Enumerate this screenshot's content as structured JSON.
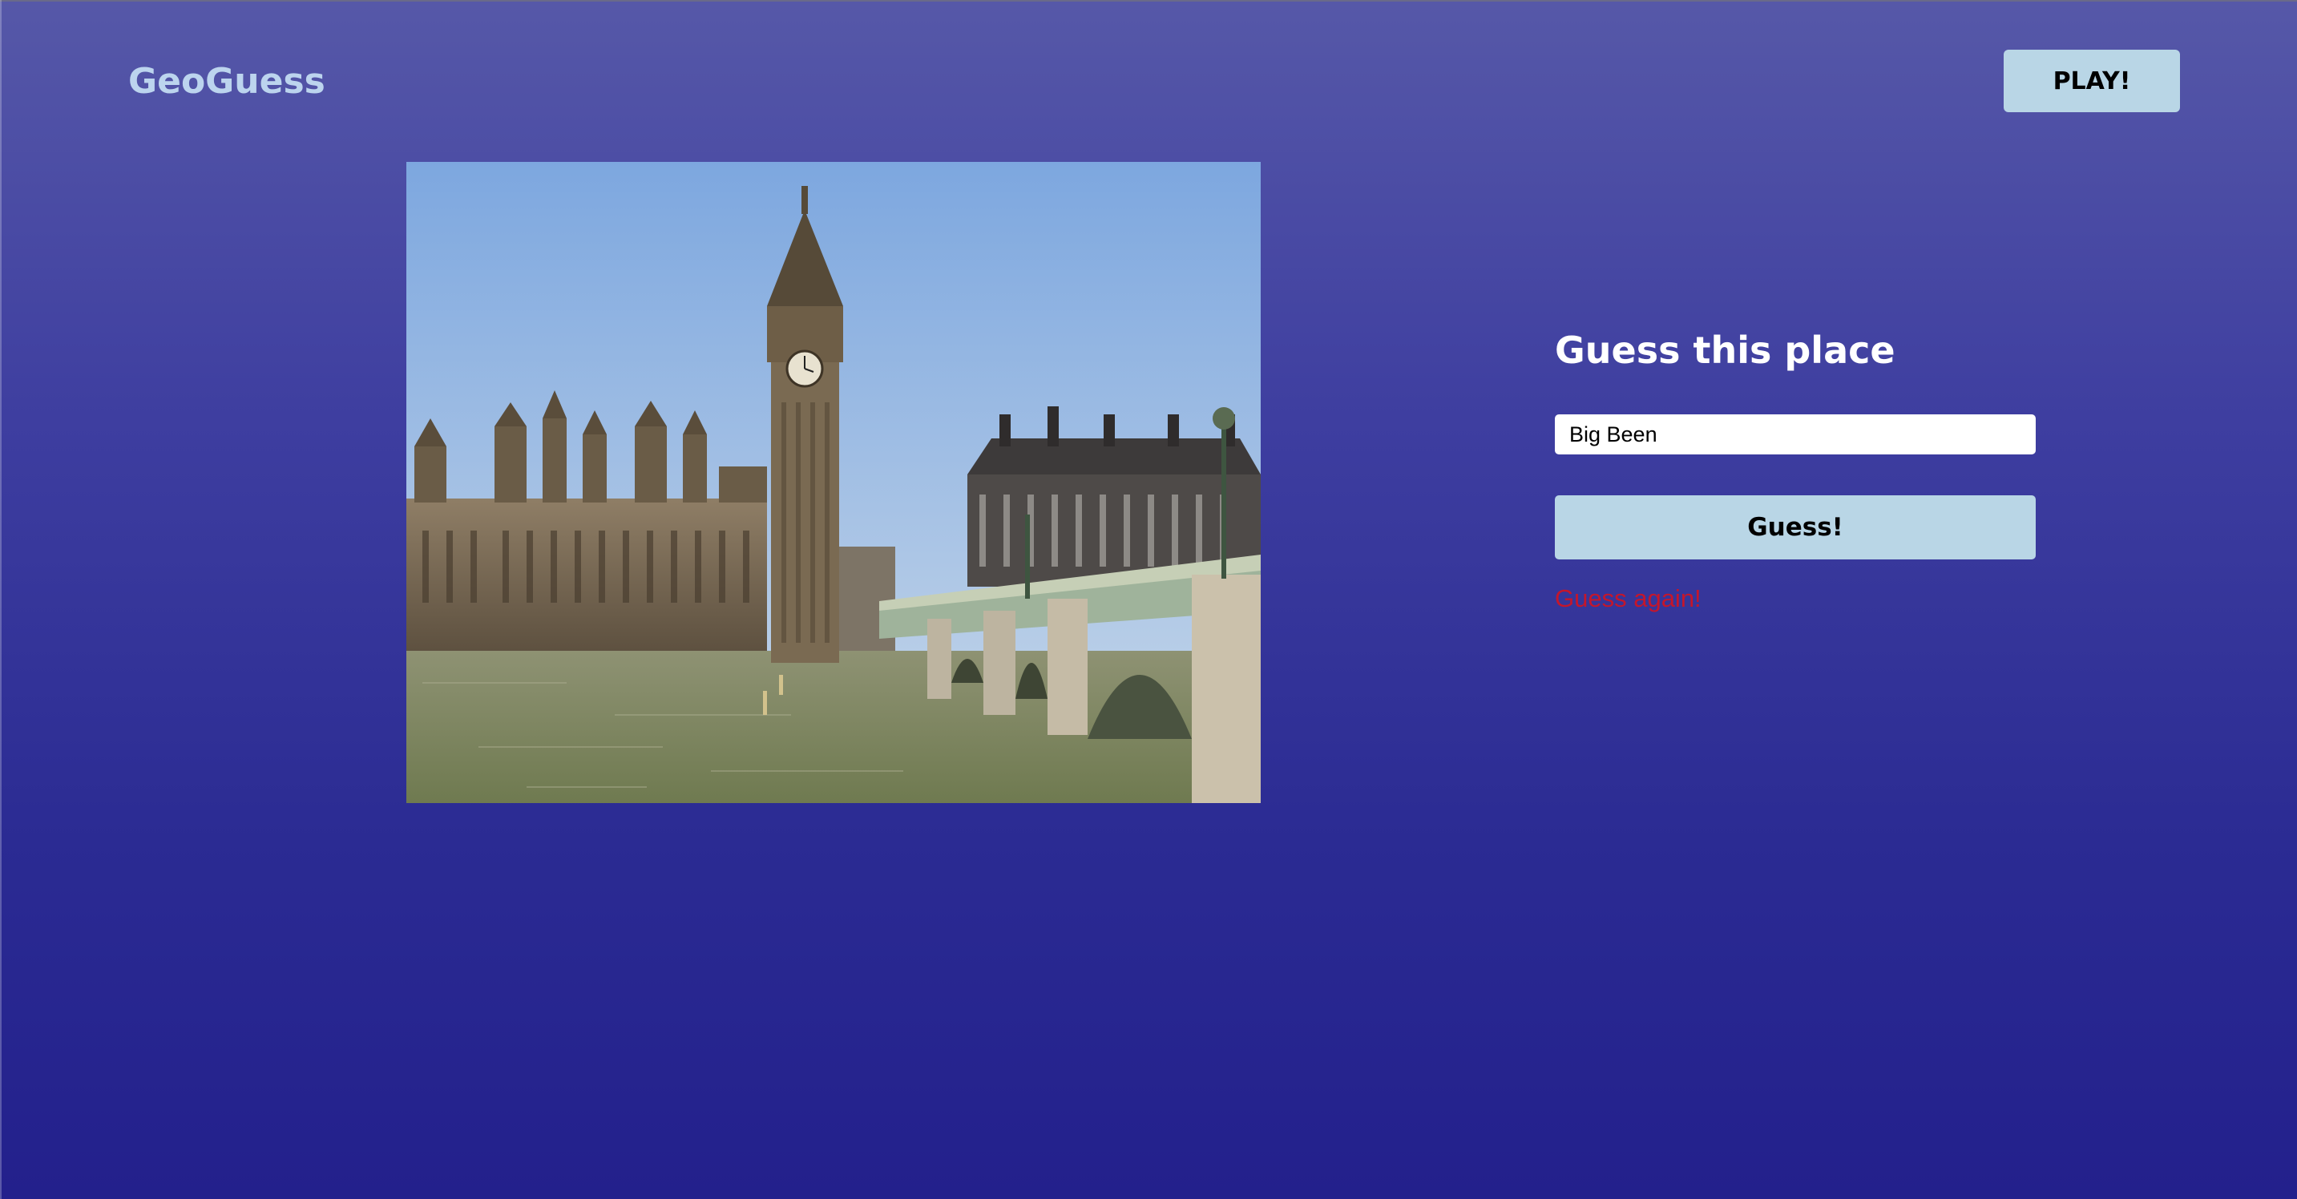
{
  "header": {
    "logo": "GeoGuess",
    "play_label": "PLAY!"
  },
  "photo": {
    "alt": "Photo of a landmark to guess"
  },
  "panel": {
    "title": "Guess this place",
    "input_value": "Big Been",
    "guess_label": "Guess!",
    "feedback": "Guess again!"
  },
  "colors": {
    "background_top": "#5658a8",
    "background_bottom": "#23208c",
    "button": "#b9d6e6",
    "logo": "#bcd4ee",
    "feedback": "#c5162b"
  }
}
